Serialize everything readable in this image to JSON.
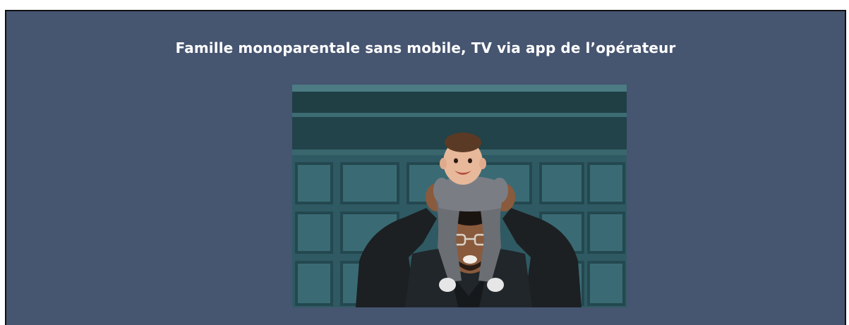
{
  "card": {
    "title": "Famille monoparentale sans mobile, TV via app de l’opérateur",
    "background_color": "#465570",
    "border_color": "#111111"
  },
  "photo": {
    "description_icon": "family-photo",
    "colors": {
      "garage_door": "#2f5a63",
      "garage_panel": "#3a6b75",
      "frame_dark": "#1d3a40",
      "jacket": "#1c2023",
      "skin": "#8a5a3c",
      "child_skin": "#e8b89a",
      "child_clothes": "#6b6e73"
    }
  }
}
